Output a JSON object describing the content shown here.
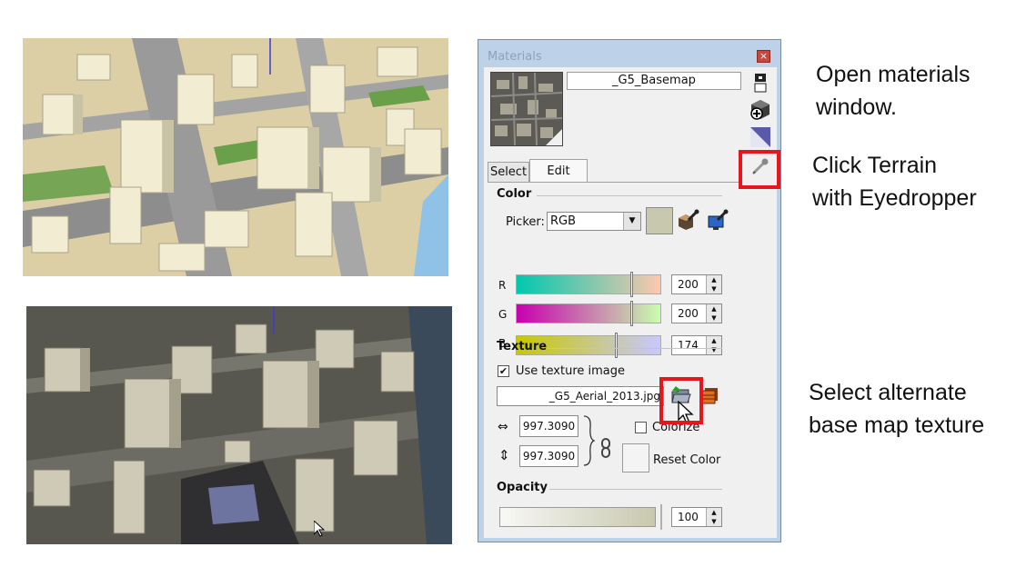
{
  "materials_window": {
    "title": "Materials",
    "close_glyph": "×",
    "material_name": "_G5_Basemap",
    "tabs": [
      {
        "label": "Select"
      },
      {
        "label": "Edit"
      }
    ],
    "color": {
      "heading": "Color",
      "picker_label": "Picker:",
      "picker_value": "RGB",
      "swatch_color": "#c8c8ae",
      "channels": [
        {
          "label": "R",
          "value": "200",
          "level": 0.78
        },
        {
          "label": "G",
          "value": "200",
          "level": 0.78
        },
        {
          "label": "B",
          "value": "174",
          "level": 0.68
        }
      ]
    },
    "texture": {
      "heading": "Texture",
      "use_texture_label": "Use texture image",
      "use_texture_checked": "✔",
      "file_name": "_G5_Aerial_2013.jpg",
      "width": "997.3090",
      "height": "997.3090",
      "colorize_label": "Colorize",
      "reset_color_label": "Reset Color"
    },
    "opacity": {
      "heading": "Opacity",
      "value": "100"
    }
  },
  "icons": [
    "close-icon",
    "display-secondary-icon",
    "create-material-icon",
    "default-material-icon",
    "eyedropper-icon",
    "match-model-color-icon",
    "match-screen-color-icon",
    "browse-texture-icon",
    "edit-texture-icon",
    "width-arrows-icon",
    "height-arrows-icon",
    "aspect-lock-icon",
    "mouse-cursor-icon"
  ],
  "callouts": {
    "step1_line1": "Open materials",
    "step1_line2": "window.",
    "step2_line1": "Click Terrain",
    "step2_line2": "with Eyedropper",
    "step3_line1": "Select alternate",
    "step3_line2": "base map texture"
  },
  "colors": {
    "highlight": "#e8161a",
    "window_frame": "#bdd2e8",
    "panel": "#f0f0f0"
  }
}
